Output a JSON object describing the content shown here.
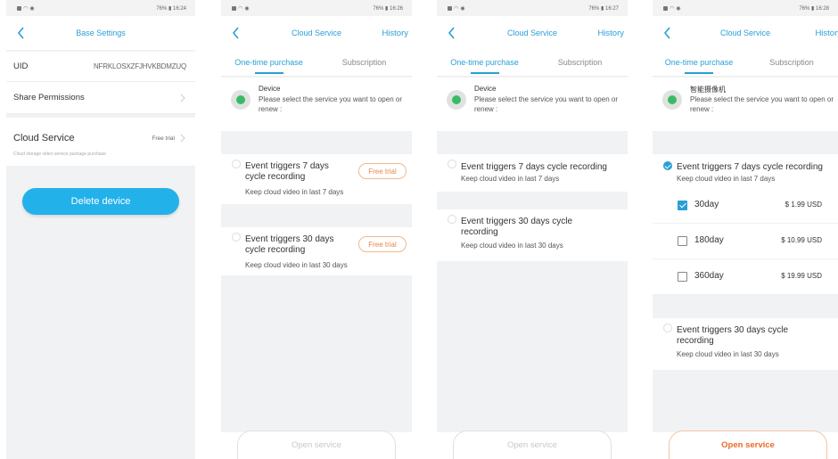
{
  "status": {
    "time1": "16:24",
    "time2": "16:26",
    "time3": "16:27",
    "time4": "16:28",
    "battery": "76%"
  },
  "screen1": {
    "title": "Base Settings",
    "uid_label": "UID",
    "uid_value": "NFRKLOSXZFJHVKBDMZUQ",
    "share_label": "Share Permissions",
    "cloud_label": "Cloud Service",
    "cloud_value": "Free trial",
    "cloud_sub": "Cloud storage video service package purchase",
    "delete_label": "Delete device"
  },
  "cloud": {
    "title": "Cloud Service",
    "history": "History",
    "tab_onetime": "One-time purchase",
    "tab_subscription": "Subscription",
    "device_name": "Device",
    "device_name_cn": "智能摄像机",
    "device_desc": "Please select the service you want to open or renew :",
    "plan7_title": "Event triggers 7 days cycle recording",
    "plan7_desc": "Keep cloud video in last 7 days",
    "plan30_title": "Event triggers 30 days cycle recording",
    "plan30_desc": "Keep cloud video in last 30 days",
    "free_trial": "Free trial",
    "open_service": "Open service",
    "options": [
      {
        "label": "30day",
        "price": "$ 1.99 USD",
        "checked": true
      },
      {
        "label": "180day",
        "price": "$ 10.99 USD",
        "checked": false
      },
      {
        "label": "360day",
        "price": "$ 19.99 USD",
        "checked": false
      }
    ]
  },
  "colors": {
    "accent": "#2a9fd6",
    "delete": "#23b1ea",
    "trial": "#e3884a",
    "open_enabled": "#ec6a2a"
  }
}
